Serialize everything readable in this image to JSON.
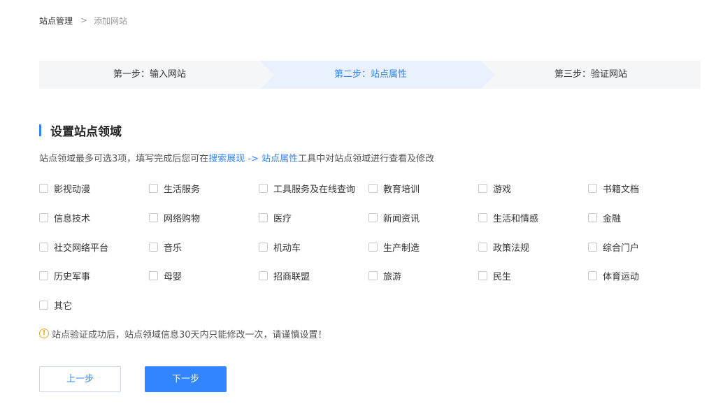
{
  "breadcrumb": {
    "root": "站点管理",
    "separator": ">",
    "current": "添加网站"
  },
  "steps": [
    {
      "label": "第一步：输入网站",
      "state": "done"
    },
    {
      "label": "第二步：站点属性",
      "state": "active"
    },
    {
      "label": "第三步：验证网站",
      "state": "pending"
    }
  ],
  "section": {
    "title": "设置站点领域"
  },
  "description": {
    "prefix": "站点领域最多可选3项，填写完成后您可在",
    "link": "搜索展现 -> 站点属性",
    "suffix": "工具中对站点领域进行查看及修改"
  },
  "domains": [
    [
      "影视动漫",
      "生活服务",
      "工具服务及在线查询",
      "教育培训",
      "游戏",
      "书籍文档"
    ],
    [
      "信息技术",
      "网络购物",
      "医疗",
      "新闻资讯",
      "生活和情感",
      "金融"
    ],
    [
      "社交网络平台",
      "音乐",
      "机动车",
      "生产制造",
      "政策法规",
      "综合门户"
    ],
    [
      "历史军事",
      "母婴",
      "招商联盟",
      "旅游",
      "民生",
      "体育运动"
    ],
    [
      "其它"
    ]
  ],
  "warning": {
    "icon": "!",
    "text": "站点验证成功后，站点领域信息30天内只能修改一次，请谨慎设置！"
  },
  "buttons": {
    "prev": "上一步",
    "next": "下一步"
  },
  "colors": {
    "accent": "#3385ff",
    "step_active_bg": "#e8f1fd",
    "step_bg": "#f5f6f8",
    "warning": "#f5a623"
  }
}
